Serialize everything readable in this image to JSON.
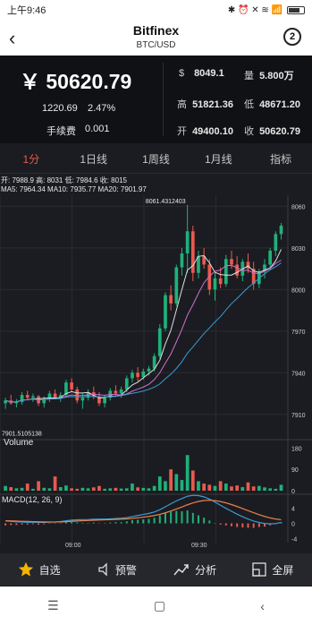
{
  "status": {
    "time": "上午9:46",
    "icons": "✱ ⏰ ✕ ≋ 📶"
  },
  "header": {
    "title": "Bitfinex",
    "pair": "BTC/USD",
    "help": "2"
  },
  "summary": {
    "price": "￥ 50620.79",
    "change": "1220.69",
    "change_pct": "2.47%",
    "fee_label": "手续费",
    "fee_value": "0.001",
    "usd_k": "$",
    "usd_v": "8049.1",
    "vol_k": "量",
    "vol_v": "5.800万",
    "high_k": "高",
    "high_v": "51821.36",
    "low_k": "低",
    "low_v": "48671.20",
    "open_k": "开",
    "open_v": "49400.10",
    "close_k": "收",
    "close_v": "50620.79"
  },
  "tabs": [
    "1分",
    "1日线",
    "1周线",
    "1月线",
    "指标"
  ],
  "ohlc_line": "开: 7988.9  高: 8031  低: 7984.6  收: 8015",
  "ma_line": "MA5: 7964.34  MA10: 7935.77  MA20: 7901.97",
  "volume_label": "Volume",
  "macd_label": "MACD(12, 26, 9)",
  "max_label": "8061.4312403",
  "min_label": "7901.5105138",
  "time_labels": [
    "09:00",
    "09:30"
  ],
  "nav": [
    {
      "label": "自选",
      "icon": "star-icon"
    },
    {
      "label": "预警",
      "icon": "bell-icon"
    },
    {
      "label": "分析",
      "icon": "chart-icon"
    },
    {
      "label": "全屏",
      "icon": "fullscreen-icon"
    }
  ],
  "colors": {
    "up": "#1fb17a",
    "down": "#e85a4f",
    "bg": "#1b1c21",
    "ma5": "#e0e0e0",
    "ma10": "#d06fd0",
    "ma20": "#3a9bd5"
  },
  "chart_data": {
    "type": "candlestick",
    "price_axis": [
      "8060",
      "8030",
      "8000",
      "7970",
      "7940",
      "7910"
    ],
    "volume_axis": [
      "180",
      "90",
      "0"
    ],
    "macd_axis": [
      "4",
      "0",
      "-4"
    ],
    "candles": [
      [
        7918,
        7922,
        7914,
        7920
      ],
      [
        7920,
        7924,
        7917,
        7918
      ],
      [
        7918,
        7921,
        7915,
        7919
      ],
      [
        7919,
        7926,
        7917,
        7924
      ],
      [
        7924,
        7927,
        7920,
        7922
      ],
      [
        7922,
        7925,
        7919,
        7923
      ],
      [
        7923,
        7924,
        7916,
        7918
      ],
      [
        7918,
        7923,
        7915,
        7921
      ],
      [
        7921,
        7927,
        7919,
        7925
      ],
      [
        7925,
        7928,
        7921,
        7922
      ],
      [
        7922,
        7926,
        7919,
        7924
      ],
      [
        7924,
        7935,
        7922,
        7933
      ],
      [
        7933,
        7936,
        7926,
        7928
      ],
      [
        7928,
        7930,
        7918,
        7920
      ],
      [
        7920,
        7925,
        7914,
        7922
      ],
      [
        7922,
        7928,
        7920,
        7926
      ],
      [
        7926,
        7930,
        7921,
        7923
      ],
      [
        7923,
        7926,
        7916,
        7918
      ],
      [
        7918,
        7924,
        7915,
        7922
      ],
      [
        7922,
        7929,
        7920,
        7927
      ],
      [
        7927,
        7931,
        7923,
        7925
      ],
      [
        7925,
        7930,
        7922,
        7928
      ],
      [
        7928,
        7938,
        7926,
        7936
      ],
      [
        7936,
        7942,
        7933,
        7940
      ],
      [
        7940,
        7944,
        7934,
        7937
      ],
      [
        7937,
        7943,
        7935,
        7941
      ],
      [
        7941,
        7945,
        7938,
        7943
      ],
      [
        7943,
        7954,
        7941,
        7952
      ],
      [
        7952,
        7975,
        7950,
        7972
      ],
      [
        7972,
        7998,
        7970,
        7996
      ],
      [
        7996,
        8003,
        7985,
        7990
      ],
      [
        7990,
        8018,
        7988,
        8016
      ],
      [
        8016,
        8030,
        8010,
        8026
      ],
      [
        8026,
        8061,
        8012,
        8042
      ],
      [
        8042,
        8046,
        8006,
        8012
      ],
      [
        8012,
        8028,
        8008,
        8024
      ],
      [
        8024,
        8030,
        8015,
        8018
      ],
      [
        8018,
        8022,
        7996,
        8000
      ],
      [
        8000,
        8012,
        7992,
        8008
      ],
      [
        8008,
        8016,
        8001,
        8004
      ],
      [
        8004,
        8025,
        8002,
        8022
      ],
      [
        8022,
        8028,
        8015,
        8018
      ],
      [
        8018,
        8024,
        8008,
        8010
      ],
      [
        8010,
        8022,
        8006,
        8020
      ],
      [
        8020,
        8026,
        8012,
        8015
      ],
      [
        8015,
        8020,
        8000,
        8004
      ],
      [
        8004,
        8015,
        8001,
        8013
      ],
      [
        8013,
        8022,
        8008,
        8018
      ],
      [
        8018,
        8030,
        8014,
        8028
      ],
      [
        8028,
        8042,
        8024,
        8040
      ],
      [
        8040,
        8048,
        8036,
        8046
      ]
    ],
    "volumes": [
      20,
      15,
      10,
      12,
      30,
      8,
      40,
      12,
      10,
      60,
      15,
      22,
      10,
      8,
      12,
      10,
      14,
      20,
      8,
      10,
      12,
      9,
      10,
      30,
      14,
      12,
      10,
      20,
      60,
      40,
      90,
      70,
      45,
      150,
      85,
      40,
      30,
      25,
      20,
      40,
      30,
      18,
      22,
      15,
      35,
      18,
      20,
      14,
      10,
      8,
      25
    ],
    "macd_hist": [
      -0.5,
      -0.4,
      -0.4,
      -0.3,
      -0.3,
      -0.2,
      -0.3,
      -0.2,
      -0.1,
      -0.1,
      0.1,
      0.3,
      0.3,
      0.2,
      0.1,
      0.1,
      0.2,
      0.1,
      0.1,
      0.2,
      0.3,
      0.3,
      0.5,
      0.8,
      0.9,
      1.0,
      1.1,
      1.4,
      2.0,
      2.6,
      2.9,
      3.1,
      3.0,
      3.2,
      2.6,
      2.0,
      1.4,
      0.7,
      0.1,
      -0.3,
      -0.5,
      -0.7,
      -0.9,
      -1.0,
      -1.1,
      -1.1,
      -0.9,
      -0.8,
      -0.5,
      -0.2,
      0.3
    ]
  }
}
